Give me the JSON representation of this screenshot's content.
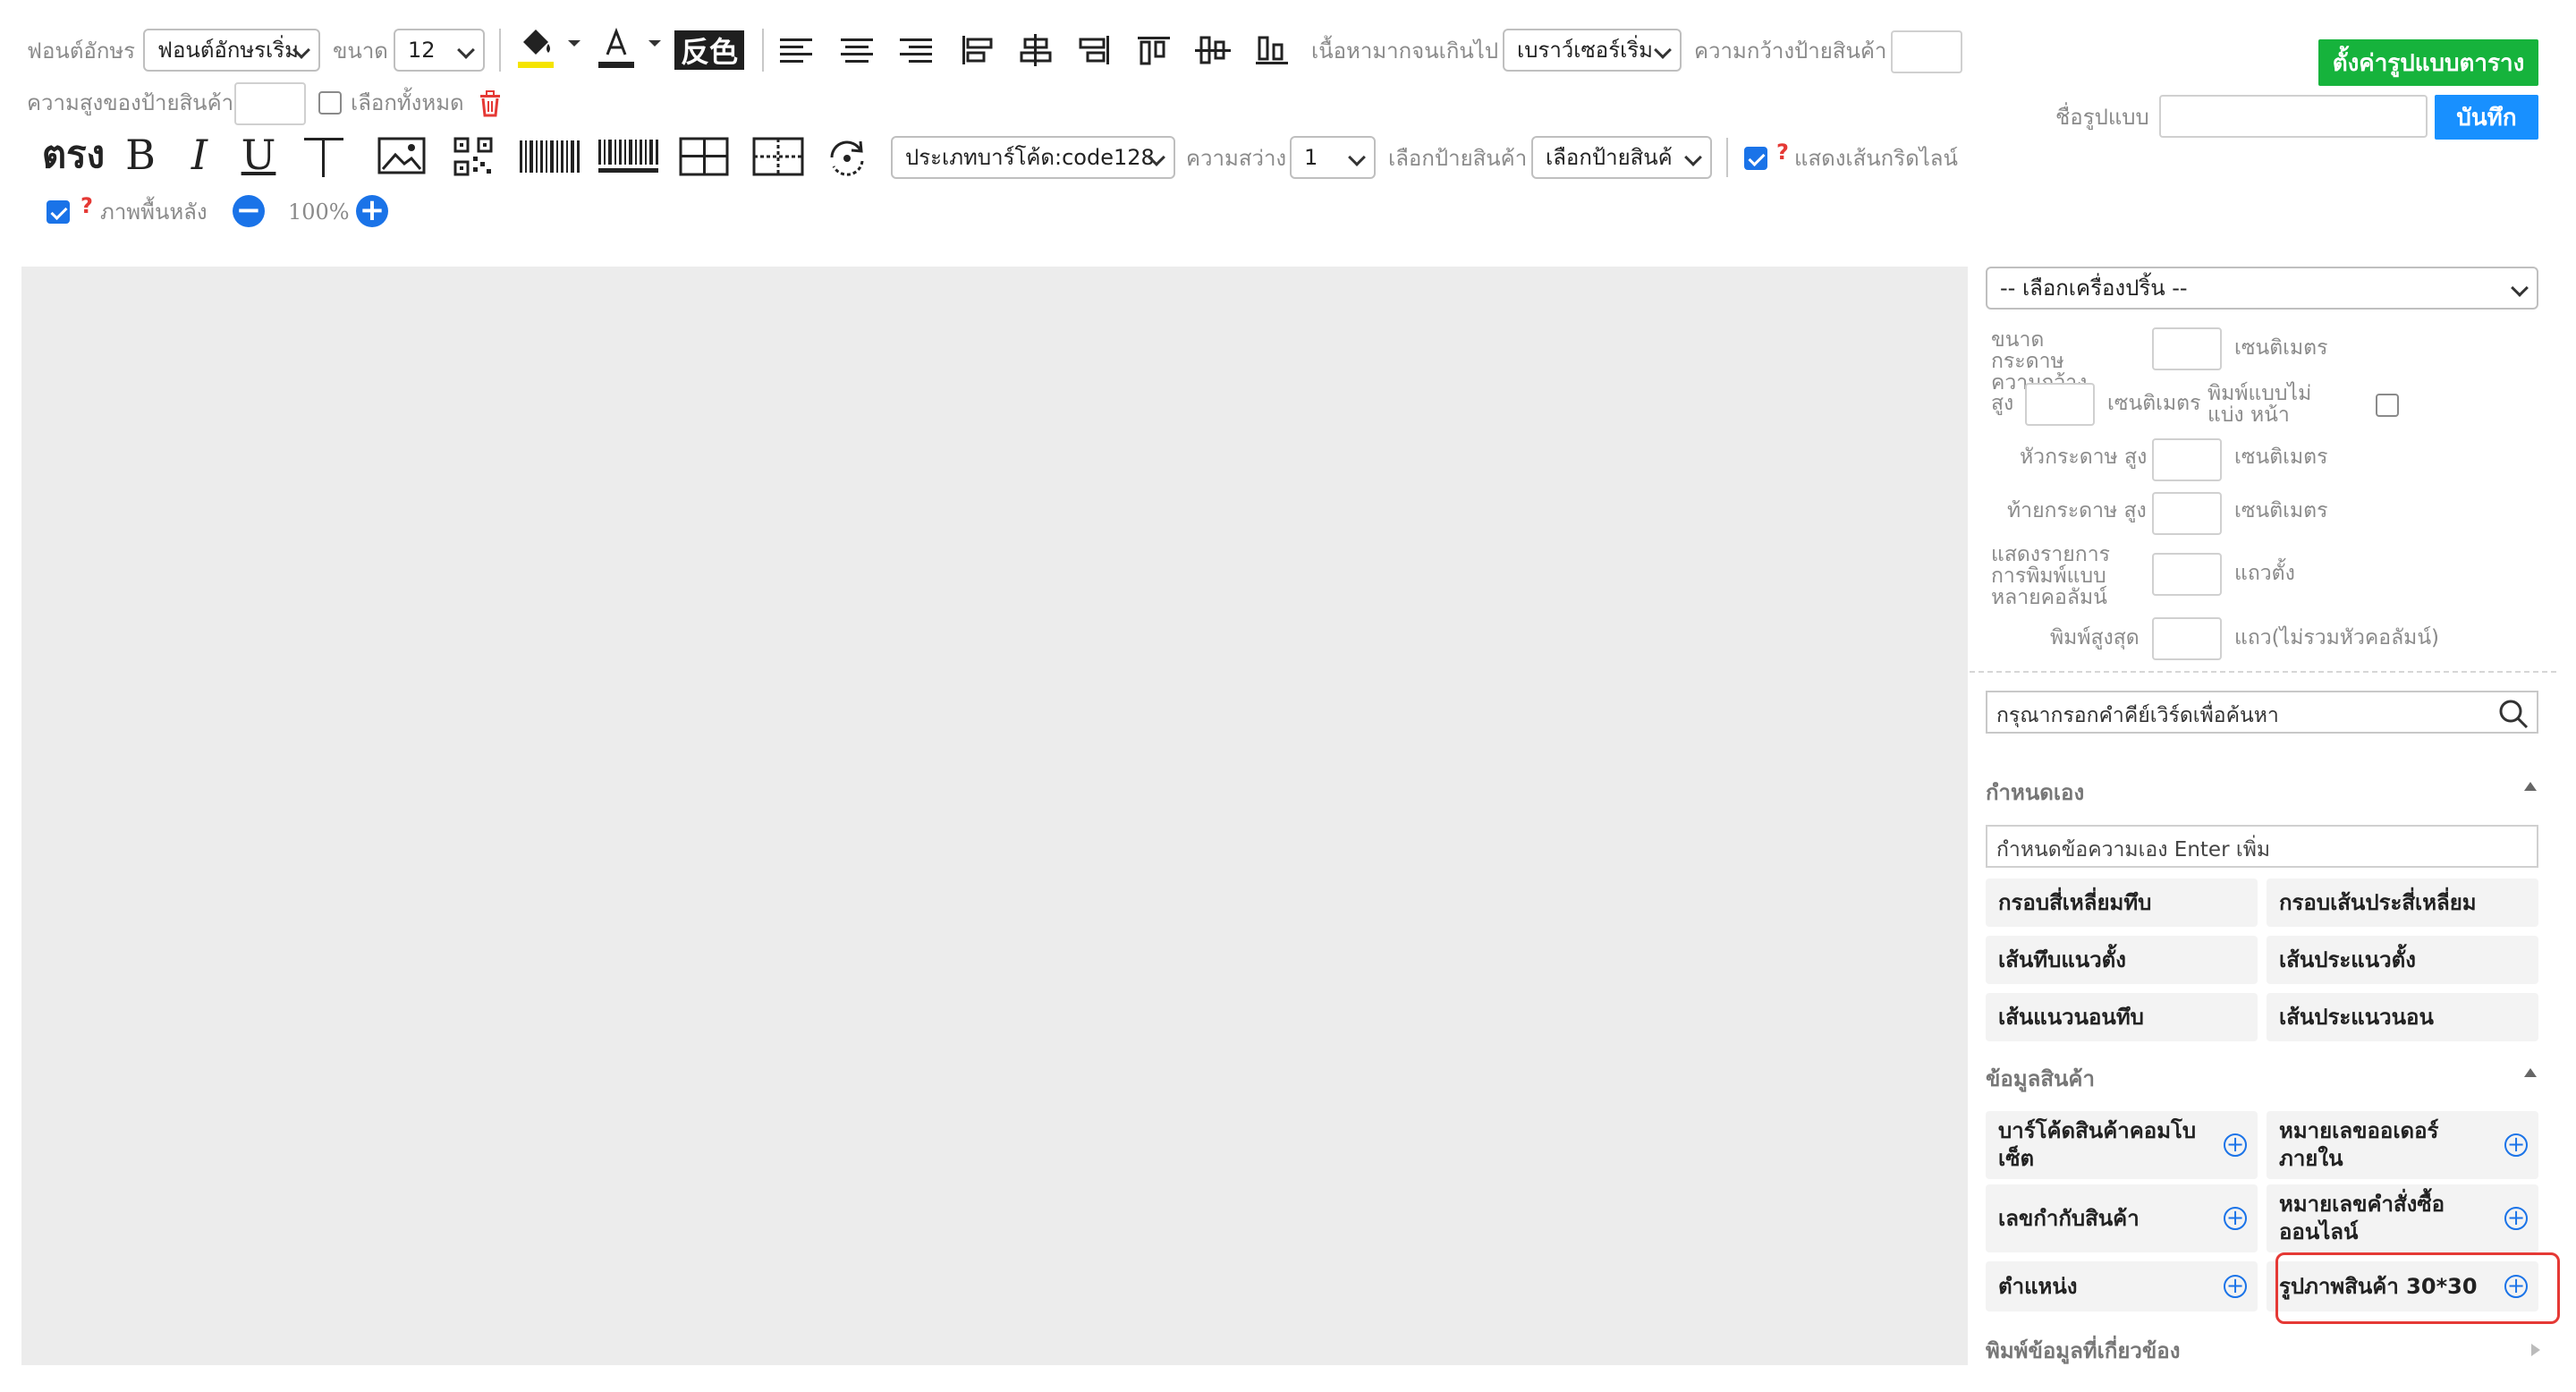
{
  "toolbar": {
    "font_label": "ฟอนต์อักษร",
    "font_value": "ฟอนต์อักษรเริ่ม",
    "size_label": "ขนาด",
    "size_value": "12",
    "invert_label": "反色",
    "overflow_label": "เนื้อหามากจนเกินไป",
    "overflow_value": "เบราว์เซอร์เริ่ม",
    "label_width_label": "ความกว้างป้ายสินค้า",
    "label_height_label": "ความสูงของป้ายสินค้า",
    "select_all_label": "เลือกทั้งหมด",
    "bold_straight": "ตรง",
    "bold": "B",
    "italic": "I",
    "underline": "U",
    "barcode_type": "ประเภทบาร์โค้ด:code128",
    "brightness_label": "ความสว่าง",
    "brightness_value": "1",
    "select_label_label": "เลือกป้ายสินค้า",
    "select_label_value": "เลือกป้ายสินค้",
    "show_grid_label": "แสดงเส้นกริดไลน์",
    "background_label": "ภาพพื้นหลัง",
    "zoom": "100%",
    "question_mark": "?",
    "minus": "−",
    "plus": "+"
  },
  "header_right": {
    "set_table_button": "ตั้งค่ารูปแบบตาราง",
    "format_name_label": "ชื่อรูปแบบ",
    "save_button": "บันทึก"
  },
  "right_panel": {
    "printer_select": "-- เลือกเครื่องปริ้น --",
    "paper_width_label": "ขนาดกระดาษ ความกว้าง",
    "height_label": "สูง",
    "no_page_break_label": "พิมพ์แบบไม่แบ่ง หน้า",
    "header_height_label": "หัวกระดาษ สูง",
    "footer_height_label": "ท้ายกระดาษ สูง",
    "multi_column_label": "แสดงรายการ การพิมพ์แบบ หลายคอลัมน์",
    "max_print_label": "พิมพ์สูงสุด",
    "unit_cm": "เซนติเมตร",
    "unit_vertical_rows": "แถวตั้ง",
    "unit_rows_excl_header": "แถว(ไม่รวมหัวคอลัมน์)",
    "search_placeholder": "กรุณากรอกคำคีย์เวิร์ดเพื่อค้นหา",
    "custom_section": "กำหนดเอง",
    "custom_text_placeholder": "กำหนดข้อความเอง Enter เพิ่ม",
    "custom_tiles": [
      "กรอบสี่เหลี่ยมทึบ",
      "กรอบเส้นประสี่เหลี่ยม",
      "เส้นทึบแนวตั้ง",
      "เส้นประแนวตั้ง",
      "เส้นแนวนอนทึบ",
      "เส้นประแนวนอน"
    ],
    "product_section": "ข้อมูลสินค้า",
    "product_tiles": [
      "บาร์โค้ดสินค้าคอมโบ เซ็ต",
      "หมายเลขออเดอร์ภายใน",
      "เลขกำกับสินค้า",
      "หมายเลขคำสั่งซื้อ ออนไลน์",
      "ตำแหน่ง",
      "รูปภาพสินค้า 30*30"
    ],
    "related_section": "พิมพ์ข้อมูลที่เกี่ยวข้อง",
    "plus_glyph": "+"
  },
  "colors": {
    "accent_blue": "#1a73e8",
    "green": "#16b33c",
    "highlight_red": "#e53935",
    "canvas_gray": "#ececec"
  }
}
